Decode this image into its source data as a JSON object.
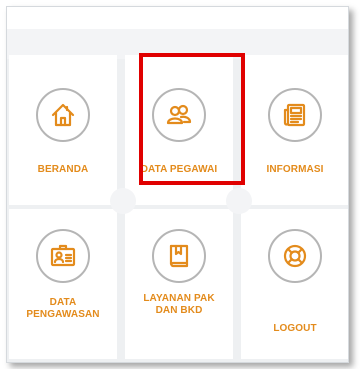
{
  "menu": {
    "items": [
      {
        "label": "BERANDA",
        "icon": "home-icon"
      },
      {
        "label": "DATA PEGAWAI",
        "icon": "users-icon"
      },
      {
        "label": "INFORMASI",
        "icon": "news-icon"
      },
      {
        "label_line1": "DATA",
        "label_line2": "PENGAWASAN",
        "icon": "id-card-icon"
      },
      {
        "label_line1": "LAYANAN PAK",
        "label_line2": "DAN BKD",
        "icon": "book-icon"
      },
      {
        "label": "LOGOUT",
        "icon": "lifebuoy-icon"
      }
    ]
  },
  "colors": {
    "accent": "#e38b1c",
    "highlight": "#e00000",
    "circle_border": "#b5b5b5",
    "background": "#eef0f2"
  }
}
